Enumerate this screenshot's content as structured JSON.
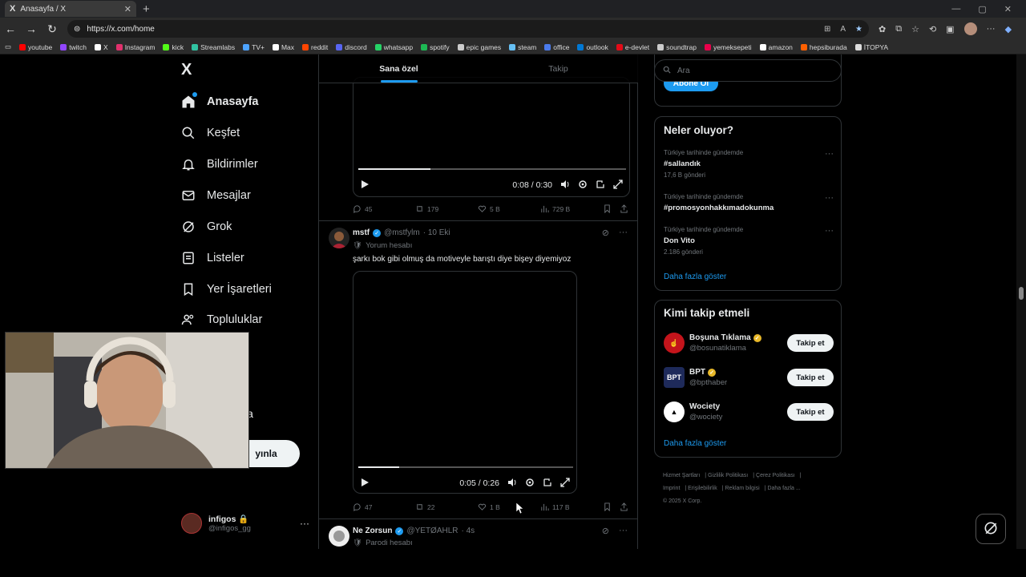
{
  "browser": {
    "tab_title": "Anasayfa / X",
    "tab_logo": "X",
    "tab_close": "✕",
    "new_tab": "+",
    "url": "https://x.com/home",
    "bookmarks": [
      {
        "label": "youtube",
        "color": "#ff0000"
      },
      {
        "label": "twitch",
        "color": "#9146ff"
      },
      {
        "label": "X",
        "color": "#ffffff"
      },
      {
        "label": "Instagram",
        "color": "#e1306c"
      },
      {
        "label": "kick",
        "color": "#53fc18"
      },
      {
        "label": "Streamlabs",
        "color": "#31c3a2"
      },
      {
        "label": "TV+",
        "color": "#4da3ff"
      },
      {
        "label": "Max",
        "color": "#ffffff"
      },
      {
        "label": "reddit",
        "color": "#ff4500"
      },
      {
        "label": "discord",
        "color": "#5865f2"
      },
      {
        "label": "whatsapp",
        "color": "#25d366"
      },
      {
        "label": "spotify",
        "color": "#1db954"
      },
      {
        "label": "epic games",
        "color": "#cccccc"
      },
      {
        "label": "steam",
        "color": "#66c0f4"
      },
      {
        "label": "office",
        "color": "#4b7bec"
      },
      {
        "label": "outlook",
        "color": "#0078d4"
      },
      {
        "label": "e-devlet",
        "color": "#e30a17"
      },
      {
        "label": "soundtrap",
        "color": "#cccccc"
      },
      {
        "label": "yemeksepeti",
        "color": "#ea004b"
      },
      {
        "label": "amazon",
        "color": "#ffffff"
      },
      {
        "label": "hepsiburada",
        "color": "#ff6000"
      },
      {
        "label": "İTOPYA",
        "color": "#dddddd"
      }
    ]
  },
  "sidebar": {
    "logo": "X",
    "items": [
      {
        "label": "Anasayfa",
        "icon": "home-icon"
      },
      {
        "label": "Keşfet",
        "icon": "search-icon"
      },
      {
        "label": "Bildirimler",
        "icon": "bell-icon"
      },
      {
        "label": "Mesajlar",
        "icon": "mail-icon"
      },
      {
        "label": "Grok",
        "icon": "grok-icon"
      },
      {
        "label": "Listeler",
        "icon": "list-icon"
      },
      {
        "label": "Yer İşaretleri",
        "icon": "bookmark-icon"
      },
      {
        "label": "Topluluklar",
        "icon": "people-icon"
      }
    ],
    "partial_label": "la",
    "post_button": "yınla",
    "account": {
      "name": "infigos 🔒",
      "handle": "@infigos_gg",
      "more": "···"
    }
  },
  "feed": {
    "tabs": [
      {
        "label": "Sana özel"
      },
      {
        "label": "Takip"
      }
    ],
    "video1": {
      "time": "0:08 / 0:30",
      "progress": 0.27
    },
    "actions1": {
      "replies": "45",
      "reposts": "179",
      "likes": "5 B",
      "views": "729 B"
    },
    "tweet2": {
      "name": "mstf",
      "handle": "@mstfylm",
      "date": "· 10 Eki",
      "sub": "Yorum hesabı",
      "text": "şarkı bok gibi olmuş da motiveyle barıştı diye bişey diyemiyoz",
      "video_time": "0:05 / 0:26",
      "progress": 0.19,
      "replies": "47",
      "reposts": "22",
      "likes": "1 B",
      "views": "117 B"
    },
    "tweet3": {
      "name": "Ne Zorsun",
      "handle": "@YETØAHLR",
      "date": "· 4s",
      "sub": "Parodi hesabı"
    },
    "more": "···"
  },
  "right": {
    "search_placeholder": "Ara",
    "subscribe": "Abone Ol",
    "trends_title": "Neler oluyor?",
    "trends": [
      {
        "context": "Türkiye tarihinde gündemde",
        "name": "#sallandık",
        "count": "17,6 B gönderi"
      },
      {
        "context": "Türkiye tarihinde gündemde",
        "name": "#promosyonhakkımadokunma",
        "count": ""
      },
      {
        "context": "Türkiye tarihinde gündemde",
        "name": "Don Vito",
        "count": "2.186 gönderi"
      }
    ],
    "show_more": "Daha fazla göster",
    "who_title": "Kimi takip etmeli",
    "who": [
      {
        "name": "Boşuna Tıklama",
        "handle": "@bosunatiklama",
        "avatar_color": "#c4141b",
        "avatar_text": "☝"
      },
      {
        "name": "BPT",
        "handle": "@bpthaber",
        "avatar_color": "#1e2a5a",
        "avatar_text": "BPT"
      },
      {
        "name": "Wociety",
        "handle": "@wociety",
        "avatar_color": "#ffffff",
        "avatar_text": "▲"
      }
    ],
    "follow_label": "Takip et",
    "show_more2": "Daha fazla göster",
    "footer": [
      "Hizmet Şartları",
      "Gizlilik Politikası",
      "Çerez Politikası",
      "Imprint",
      "Erişilebilirlik",
      "Reklam bilgisi",
      "Daha fazla ...",
      "© 2025 X Corp."
    ]
  }
}
